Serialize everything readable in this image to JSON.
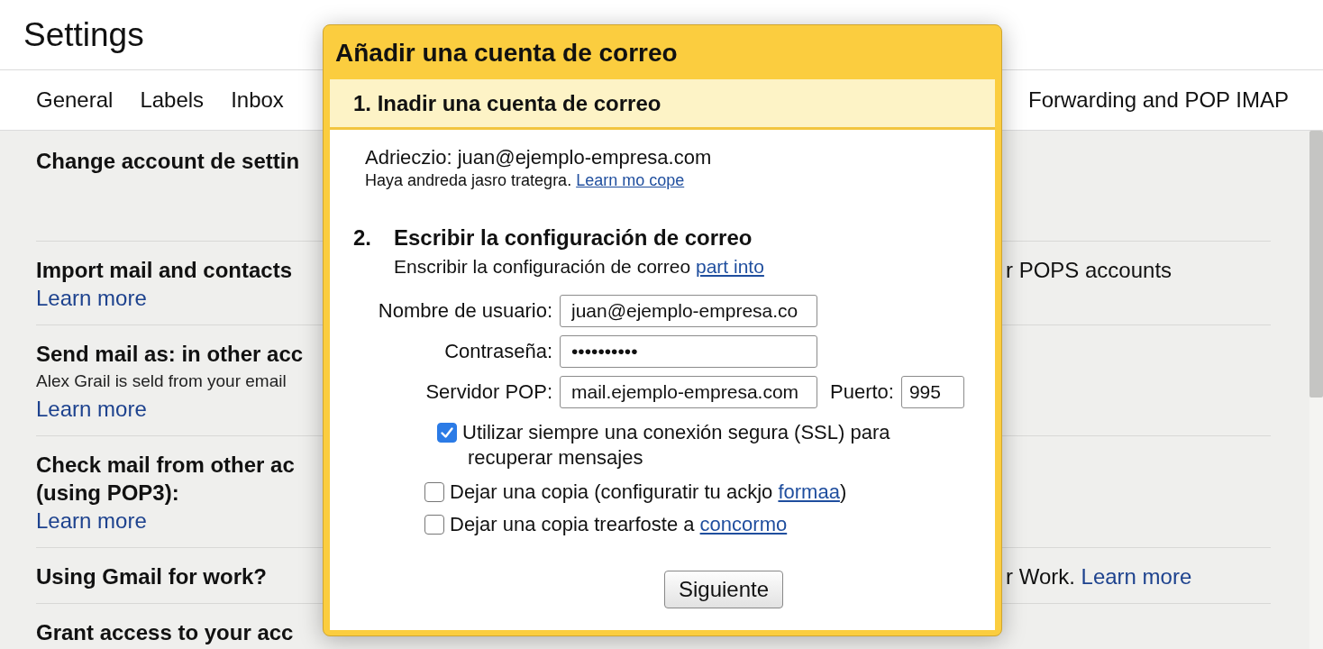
{
  "window": {
    "title": "Settings"
  },
  "tabs": [
    {
      "label": "General",
      "selected": false
    },
    {
      "label": "Labels",
      "selected": false
    },
    {
      "label": "Inbox",
      "selected": false
    },
    {
      "label": "Forwarding and POP IMAP",
      "selected": false
    }
  ],
  "settings_rows": [
    {
      "heading_lines": [
        "Change account de settin"
      ]
    },
    {
      "heading_lines": [
        "Import mail and contacts"
      ],
      "link": "Learn more",
      "value": "r POPS accounts"
    },
    {
      "heading_lines": [
        "Send mail as: in other acc"
      ],
      "note": "Alex Grail is seld from your email",
      "link": "Learn more"
    },
    {
      "heading_lines": [
        "Check mail from other ac",
        "(using POP3):"
      ],
      "link": "Learn more"
    },
    {
      "heading_lines": [
        "Using Gmail for work?"
      ],
      "value": "r Work.",
      "value_link": "Learn more"
    },
    {
      "heading_lines": [
        "Grant access to your acc"
      ]
    }
  ],
  "dialog": {
    "title": "Añadir una cuenta de correo",
    "step_1": {
      "title": "1. Inadir una cuenta de correo",
      "address": "Adrieczio: juan@ejemplo-empresa.com",
      "note": "Haya andreda jasro trategra.",
      "link": "Learn mo cope"
    },
    "step_2": {
      "number": "2.",
      "title": "Escribir la configuración de correo",
      "intro": "Enscribir la configuración de correo",
      "link": "part into"
    },
    "fields": [
      {
        "label": "Nombre de usuario:",
        "value": "juan@ejemplo-empresa.co"
      },
      {
        "label": "Contraseña:",
        "value": "••••••••••"
      },
      {
        "label": "Servidor POP:",
        "value": "mail.ejemplo-empresa.com"
      }
    ],
    "port": {
      "label": "Puerto:",
      "value": "995"
    },
    "options": [
      {
        "label": "Utilizar siempre una conexión segura (SSL) para recuperar mensajes",
        "checked": true
      },
      {
        "label": "Dejar una copia (configuratir tu ackjo",
        "link": "formaa",
        "suffix": ")",
        "checked": false
      },
      {
        "label": "Dejar una copia trearfoste a",
        "link": "concormo",
        "checked": false
      }
    ],
    "button": "Siguiente"
  }
}
